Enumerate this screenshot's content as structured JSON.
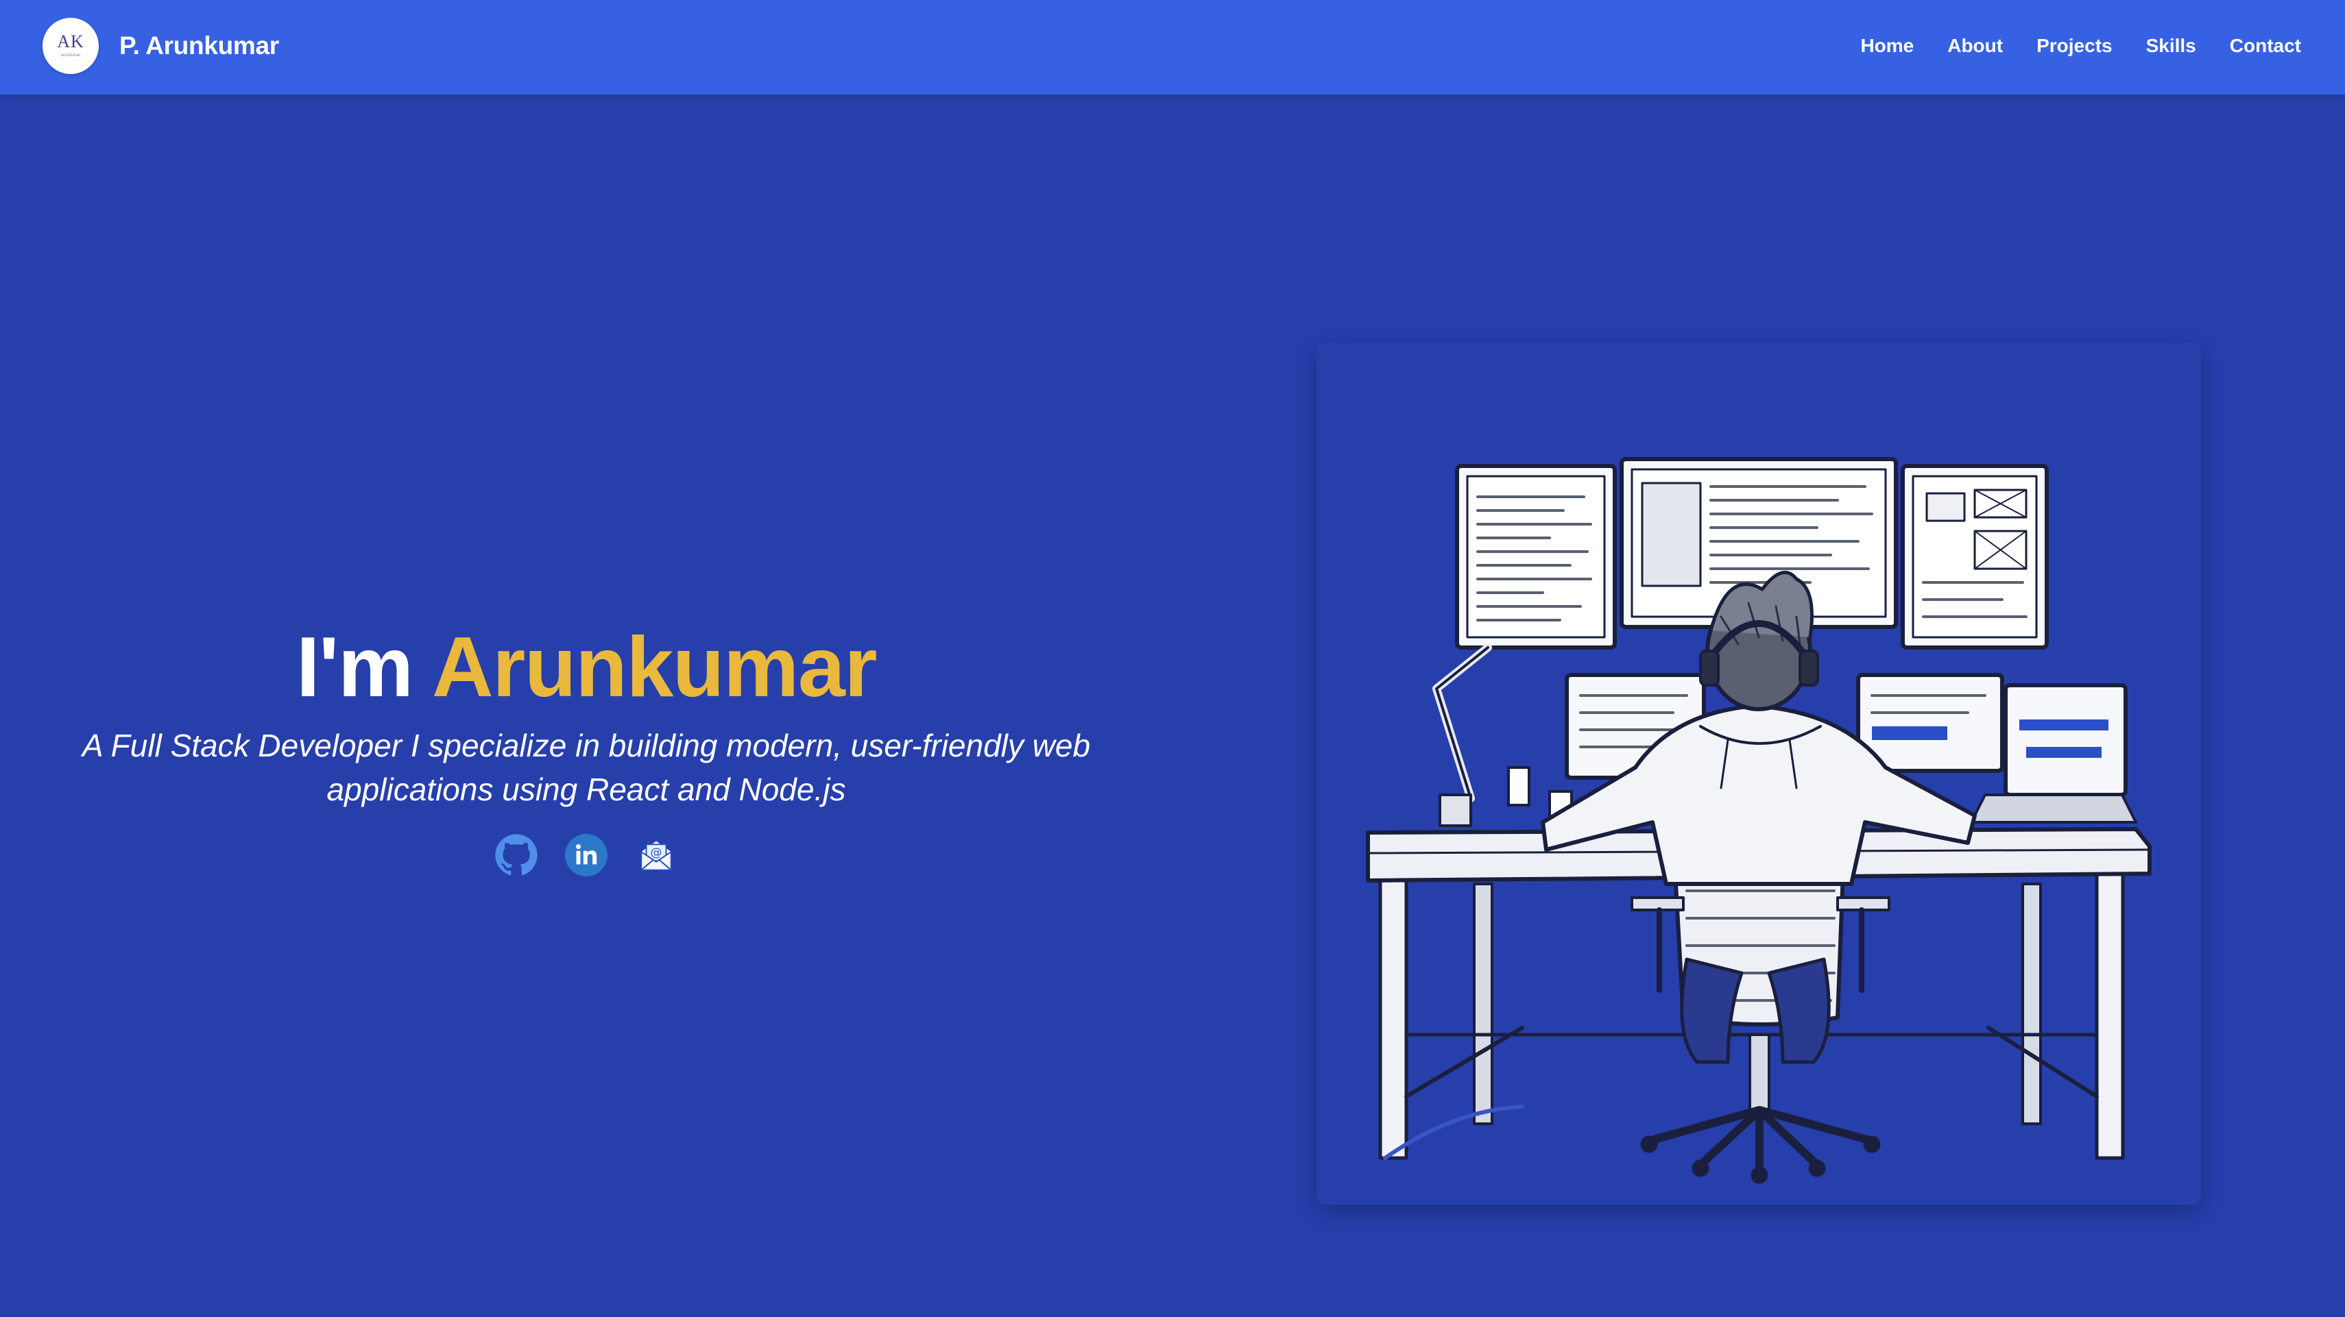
{
  "navbar": {
    "logo_initials": "AK",
    "logo_subtext": "arunkumar",
    "brand_name": "P. Arunkumar",
    "links": [
      "Home",
      "About",
      "Projects",
      "Skills",
      "Contact"
    ]
  },
  "hero": {
    "title_prefix": "I'm ",
    "title_name": "Arunkumar",
    "subtitle_line1": "A Full Stack Developer I specialize in building modern, user-friendly web",
    "subtitle_line2": "applications using React and Node.js",
    "social_icons": [
      "github-icon",
      "linkedin-icon",
      "email-icon"
    ]
  },
  "colors": {
    "navbar_bg": "#3761e3",
    "page_bg": "#263fab",
    "accent": "#e9b83d",
    "text": "#ffffff"
  }
}
